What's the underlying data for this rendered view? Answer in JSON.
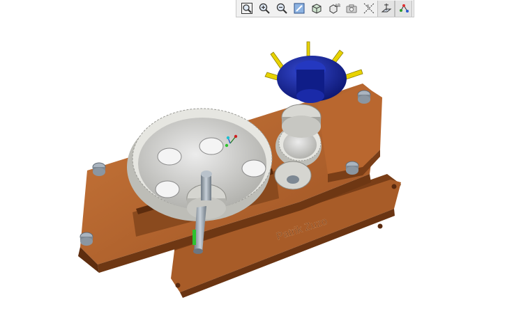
{
  "toolbar": {
    "buttons": [
      {
        "icon": "zoom-fit-icon"
      },
      {
        "icon": "zoom-in-icon"
      },
      {
        "icon": "zoom-out-icon"
      },
      {
        "icon": "repaint-icon"
      },
      {
        "icon": "view-orientation-icon"
      },
      {
        "icon": "saved-views-icon"
      },
      {
        "icon": "camera-icon"
      },
      {
        "icon": "datum-axes-icon"
      },
      {
        "icon": "datum-planes-icon"
      },
      {
        "icon": "datum-points-icon"
      }
    ]
  },
  "model": {
    "engraving_text": "Patrik Zuzo",
    "colors": {
      "housing": "#b8672e",
      "housing_dark": "#7a3e17",
      "gear": "#d9d9d4",
      "shaft": "#9aa6b0",
      "wheel": "#1c2a9a",
      "spokes": "#e8d300",
      "bolt": "#aab4bf"
    }
  }
}
